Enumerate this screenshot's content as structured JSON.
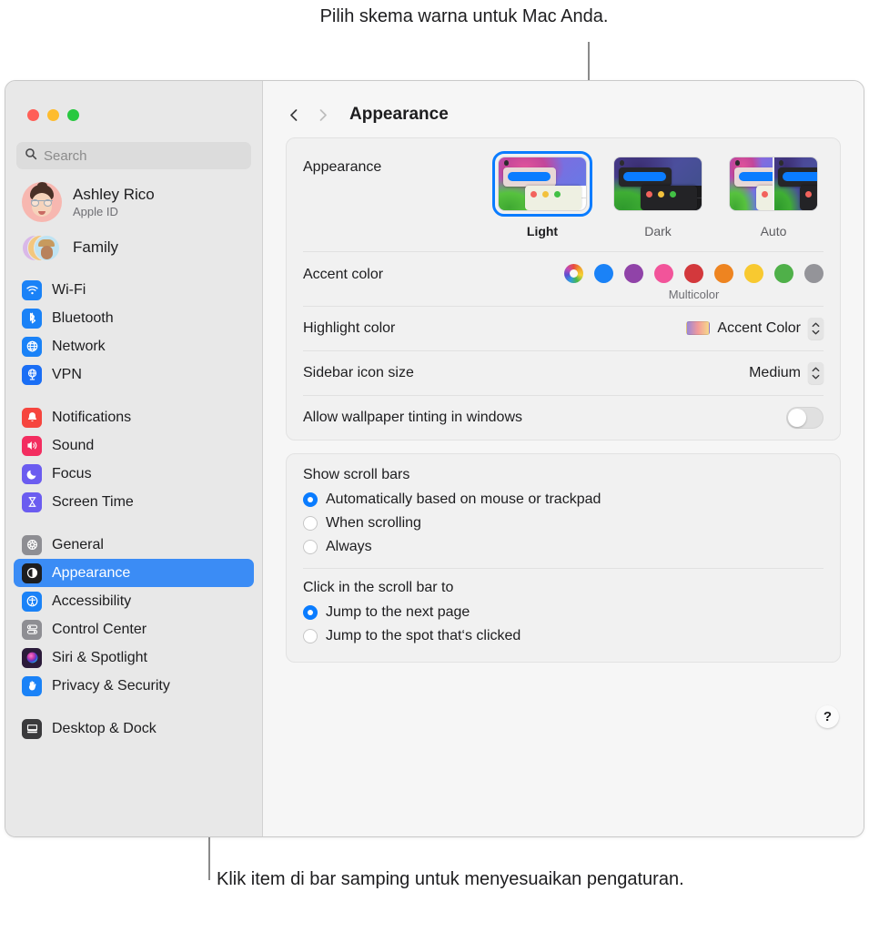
{
  "callouts": {
    "top": "Pilih skema warna untuk Mac Anda.",
    "bottom": "Klik item di bar samping untuk menyesuaikan pengaturan."
  },
  "window": {
    "traffic_lights": [
      "close",
      "minimize",
      "zoom"
    ],
    "toolbar": {
      "back": "‹",
      "forward": "›",
      "title": "Appearance"
    }
  },
  "sidebar": {
    "search": {
      "placeholder": "Search",
      "value": ""
    },
    "account": {
      "name": "Ashley Rico",
      "subtitle": "Apple ID"
    },
    "family": {
      "label": "Family"
    },
    "groups": [
      {
        "items": [
          {
            "label": "Wi-Fi",
            "icon": "wifi-icon",
            "color": "#1a82f7"
          },
          {
            "label": "Bluetooth",
            "icon": "bluetooth-icon",
            "color": "#1a82f7"
          },
          {
            "label": "Network",
            "icon": "globe-icon",
            "color": "#1a82f7"
          },
          {
            "label": "VPN",
            "icon": "vpn-globe-icon",
            "color": "#1a6ef5"
          }
        ]
      },
      {
        "items": [
          {
            "label": "Notifications",
            "icon": "bell-icon",
            "color": "#f6453e"
          },
          {
            "label": "Sound",
            "icon": "speaker-icon",
            "color": "#f32d60"
          },
          {
            "label": "Focus",
            "icon": "moon-icon",
            "color": "#6b5cf0"
          },
          {
            "label": "Screen Time",
            "icon": "hourglass-icon",
            "color": "#6b5cf0"
          }
        ]
      },
      {
        "items": [
          {
            "label": "General",
            "icon": "gear-icon",
            "color": "#8e8e93"
          },
          {
            "label": "Appearance",
            "icon": "appearance-icon",
            "color": "#1d1d1f",
            "selected": true
          },
          {
            "label": "Accessibility",
            "icon": "accessibility-icon",
            "color": "#1a82f7"
          },
          {
            "label": "Control Center",
            "icon": "control-center-icon",
            "color": "#8e8e93"
          },
          {
            "label": "Siri & Spotlight",
            "icon": "siri-icon",
            "color": "#2b1b3a"
          },
          {
            "label": "Privacy & Security",
            "icon": "hand-icon",
            "color": "#1a82f7"
          }
        ]
      },
      {
        "items": [
          {
            "label": "Desktop & Dock",
            "icon": "desktop-dock-icon",
            "color": "#3a3a3c"
          }
        ]
      }
    ],
    "selected_accent": "#3b8cf5"
  },
  "main": {
    "appearance": {
      "label": "Appearance",
      "options": [
        {
          "name": "Light",
          "selected": true
        },
        {
          "name": "Dark",
          "selected": false
        },
        {
          "name": "Auto",
          "selected": false
        }
      ]
    },
    "accent_color": {
      "label": "Accent color",
      "caption": "Multicolor",
      "swatches": [
        {
          "name": "multicolor",
          "selected": true
        },
        {
          "name": "blue",
          "hex": "#1a82f7"
        },
        {
          "name": "purple",
          "hex": "#9043a8"
        },
        {
          "name": "pink",
          "hex": "#f2549a"
        },
        {
          "name": "red",
          "hex": "#d3383c"
        },
        {
          "name": "orange",
          "hex": "#ee8420"
        },
        {
          "name": "yellow",
          "hex": "#f8c930"
        },
        {
          "name": "green",
          "hex": "#4fb049"
        },
        {
          "name": "graphite",
          "hex": "#949499"
        }
      ]
    },
    "highlight_color": {
      "label": "Highlight color",
      "value": "Accent Color"
    },
    "sidebar_icon_size": {
      "label": "Sidebar icon size",
      "value": "Medium"
    },
    "wallpaper_tinting": {
      "label": "Allow wallpaper tinting in windows",
      "enabled": false
    },
    "show_scroll_bars": {
      "label": "Show scroll bars",
      "options": [
        {
          "label": "Automatically based on mouse or trackpad",
          "selected": true
        },
        {
          "label": "When scrolling",
          "selected": false
        },
        {
          "label": "Always",
          "selected": false
        }
      ]
    },
    "click_scroll_bar": {
      "label": "Click in the scroll bar to",
      "options": [
        {
          "label": "Jump to the next page",
          "selected": true
        },
        {
          "label": "Jump to the spot that‘s clicked",
          "selected": false
        }
      ]
    },
    "help": {
      "label": "?"
    }
  }
}
